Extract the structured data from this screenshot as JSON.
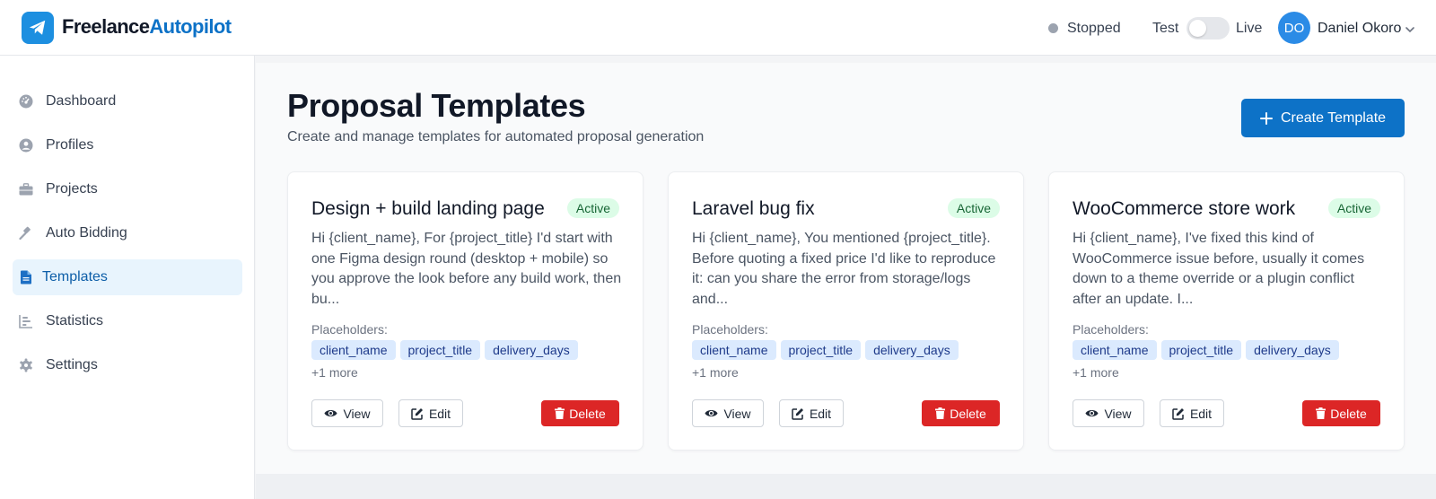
{
  "brand": {
    "name_part1": "Freelance",
    "name_part2": "Autopilot",
    "icon": "paper-plane-icon",
    "color": "#0d72c7"
  },
  "header": {
    "status": "Stopped",
    "mode_test": "Test",
    "mode_live": "Live",
    "mode_is_live": false,
    "user_initials": "DO",
    "user_name": "Daniel Okoro"
  },
  "sidebar": {
    "items": [
      {
        "label": "Dashboard",
        "icon": "gauge-icon",
        "active": false
      },
      {
        "label": "Profiles",
        "icon": "user-circle-icon",
        "active": false
      },
      {
        "label": "Projects",
        "icon": "briefcase-icon",
        "active": false
      },
      {
        "label": "Auto Bidding",
        "icon": "gavel-icon",
        "active": false
      },
      {
        "label": "Templates",
        "icon": "file-icon",
        "active": true
      },
      {
        "label": "Statistics",
        "icon": "chart-icon",
        "active": false
      },
      {
        "label": "Settings",
        "icon": "gear-icon",
        "active": false
      }
    ]
  },
  "main": {
    "title": "Proposal Templates",
    "subtitle": "Create and manage templates for automated proposal generation",
    "create_label": "Create Template",
    "placeholders_label": "Placeholders:",
    "view_label": "View",
    "edit_label": "Edit",
    "delete_label": "Delete",
    "cards": [
      {
        "title": "Design + build landing page",
        "status": "Active",
        "body": "Hi {client_name}, For {project_title} I'd start with one Figma design round (desktop + mobile) so you approve the look before any build work, then bu...",
        "tags": [
          "client_name",
          "project_title",
          "delivery_days"
        ],
        "more": "+1 more"
      },
      {
        "title": "Laravel bug fix",
        "status": "Active",
        "body": "Hi {client_name}, You mentioned {project_title}. Before quoting a fixed price I'd like to reproduce it: can you share the error from storage/logs and...",
        "tags": [
          "client_name",
          "project_title",
          "delivery_days"
        ],
        "more": "+1 more"
      },
      {
        "title": "WooCommerce store work",
        "status": "Active",
        "body": "Hi {client_name}, I've fixed this kind of WooCommerce issue before, usually it comes down to a theme override or a plugin conflict after an update. I...",
        "tags": [
          "client_name",
          "project_title",
          "delivery_days"
        ],
        "more": "+1 more"
      }
    ]
  },
  "colors": {
    "primary": "#0d72c7",
    "danger": "#dc2626",
    "active_badge_bg": "#dcfce7",
    "tag_bg": "#dbeafe"
  }
}
